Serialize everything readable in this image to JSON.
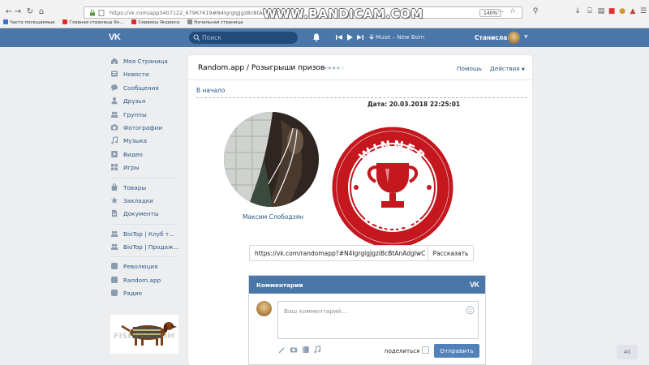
{
  "browser": {
    "url": "https://vk.com/app3407122_67967619#N4IgrglgJgzBcBtAnAdgIwC",
    "zoom": "140%",
    "bookmarks": [
      "Часто посещаемые",
      "Главная страница Ян...",
      "Сервисы Яндекса",
      "Начальная страница"
    ]
  },
  "watermark": "WWW.BANDICAM.COM",
  "header": {
    "search_placeholder": "Поиск",
    "track": "Muse – New Born",
    "user_name": "Станислав"
  },
  "sidebar": {
    "main": [
      "Моя Страница",
      "Новости",
      "Сообщения",
      "Друзья",
      "Группы",
      "Фотографии",
      "Музыка",
      "Видео",
      "Игры"
    ],
    "secondary": [
      "Товары",
      "Закладки",
      "Документы"
    ],
    "groups": [
      "BioTop | Клуб т...",
      "BioTop | Продаж..."
    ],
    "apps": [
      "Революция",
      "Random.app",
      "Радио"
    ],
    "ad_text": "FISHEAK.COM"
  },
  "app": {
    "title": "Random.app / Розыгрыши призов",
    "stars": "★★★★☆",
    "help": "Помощь",
    "actions": "Действия",
    "back": "В начало",
    "date": "Дата: 20.03.2018 22:25:01",
    "winner_name": "Максим Слободзян",
    "stamp_text_top": "WINNER",
    "stamp_text_bottom": "WINNER",
    "share_url": "https://vk.com/randomapp?#N4IgrglgJgziBcBtAnAdgIwC",
    "share_button": "Рассказать"
  },
  "comments": {
    "title": "Комментарии",
    "logo": "VK",
    "placeholder": "Ваш комментарий...",
    "share_label": "поделиться",
    "send": "Отправить"
  },
  "page_counter": "40",
  "colors": {
    "vk_blue": "#4a76a8",
    "link": "#2a5885",
    "stamp_red": "#c4171e",
    "button": "#5181b8"
  }
}
